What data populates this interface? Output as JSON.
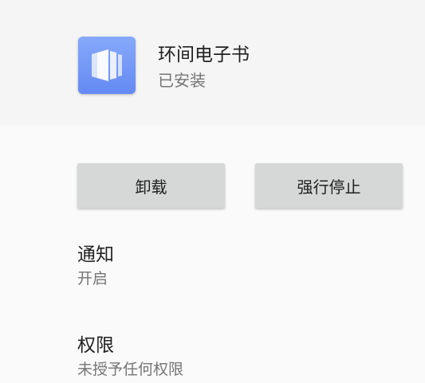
{
  "app": {
    "name": "环间电子书",
    "status": "已安装",
    "icon": "book-pages-icon",
    "icon_color": "#6f96f6"
  },
  "actions": {
    "uninstall_label": "卸载",
    "force_stop_label": "强行停止"
  },
  "settings": [
    {
      "title": "通知",
      "subtitle": "开启"
    },
    {
      "title": "权限",
      "subtitle": "未授予任何权限"
    }
  ]
}
